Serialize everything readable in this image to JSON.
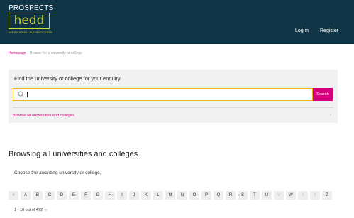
{
  "header": {
    "logo": {
      "brand": "PROSPECTS",
      "product": "hedd",
      "tagline": "VERIFICATION • AUTHENTICATION"
    },
    "login_label": "Log in",
    "register_label": "Register",
    "background_color": "#0f3547",
    "logo_accent_color": "#cddc39"
  },
  "breadcrumb": {
    "home": "Homepage",
    "current": "Browse for a university or college"
  },
  "search_panel": {
    "title": "Find the university or college for your enquiry",
    "input_value": "",
    "button_label": "Search",
    "browse_link": "Browse all universities and colleges",
    "focus_color": "#f2b01e",
    "accent_color": "#d6007e"
  },
  "listing": {
    "title": "Browsing all universities and colleges",
    "subtitle": "Choose the awarding university or college.",
    "alphabet": [
      "#",
      "A",
      "B",
      "C",
      "D",
      "E",
      "F",
      "G",
      "H",
      "I",
      "J",
      "K",
      "L",
      "M",
      "N",
      "O",
      "P",
      "Q",
      "R",
      "S",
      "T",
      "U",
      "V",
      "W",
      "X",
      "Y",
      "Z"
    ],
    "disabled_letters": [
      "V",
      "X",
      "Y"
    ],
    "pagination_text": "1 - 10  out of 472"
  }
}
